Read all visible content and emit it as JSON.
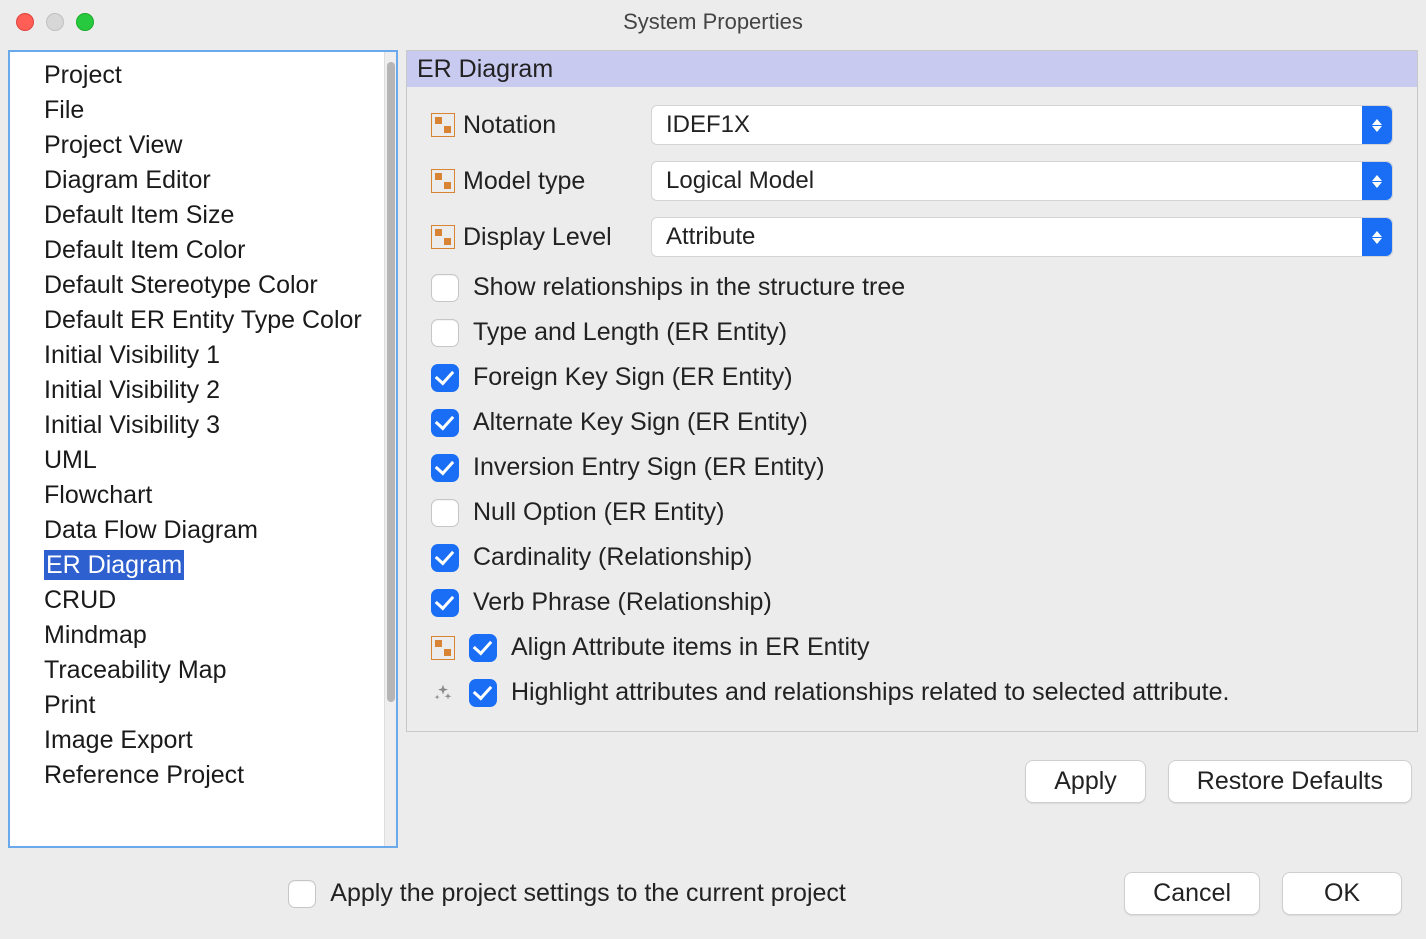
{
  "window": {
    "title": "System Properties"
  },
  "sidebar": {
    "items": [
      "Project",
      "File",
      "Project View",
      "Diagram Editor",
      "Default Item Size",
      "Default Item Color",
      "Default Stereotype Color",
      "Default ER Entity Type Color",
      "Initial Visibility 1",
      "Initial Visibility 2",
      "Initial Visibility 3",
      "UML",
      "Flowchart",
      "Data Flow Diagram",
      "ER Diagram",
      "CRUD",
      "Mindmap",
      "Traceability Map",
      "Print",
      "Image Export",
      "Reference Project"
    ],
    "selectedIndex": 14
  },
  "panel": {
    "title": "ER Diagram",
    "fields": {
      "notation": {
        "label": "Notation",
        "value": "IDEF1X"
      },
      "modelType": {
        "label": "Model type",
        "value": "Logical Model"
      },
      "displayLevel": {
        "label": "Display Level",
        "value": "Attribute"
      }
    },
    "checks": [
      {
        "label": "Show relationships in the structure tree",
        "checked": false,
        "leading": "none"
      },
      {
        "label": "Type and Length (ER Entity)",
        "checked": false,
        "leading": "none"
      },
      {
        "label": "Foreign Key Sign (ER Entity)",
        "checked": true,
        "leading": "none"
      },
      {
        "label": "Alternate Key Sign (ER Entity)",
        "checked": true,
        "leading": "none"
      },
      {
        "label": "Inversion Entry Sign (ER Entity)",
        "checked": true,
        "leading": "none"
      },
      {
        "label": "Null Option (ER Entity)",
        "checked": false,
        "leading": "none"
      },
      {
        "label": "Cardinality (Relationship)",
        "checked": true,
        "leading": "none"
      },
      {
        "label": "Verb Phrase (Relationship)",
        "checked": true,
        "leading": "none"
      },
      {
        "label": "Align Attribute items in ER Entity",
        "checked": true,
        "leading": "decor"
      },
      {
        "label": "Highlight attributes and relationships related to selected attribute.",
        "checked": true,
        "leading": "sparkle"
      }
    ]
  },
  "buttons": {
    "apply": "Apply",
    "restore": "Restore Defaults",
    "cancel": "Cancel",
    "ok": "OK"
  },
  "footer": {
    "applyToCurrent": {
      "label": "Apply the project settings to the current project",
      "checked": false
    }
  }
}
